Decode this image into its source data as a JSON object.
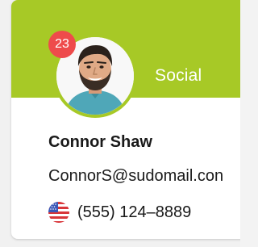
{
  "contact": {
    "category": "Social",
    "badge_count": "23",
    "name": "Connor Shaw",
    "email": "ConnorS@sudomail.con",
    "phone": "(555) 124–8889"
  },
  "icons": {
    "avatar": "person-photo",
    "flag": "us-flag-icon"
  },
  "colors": {
    "header": "#a7c926",
    "badge": "#ee4b4b",
    "text": "#1a1a1a"
  }
}
